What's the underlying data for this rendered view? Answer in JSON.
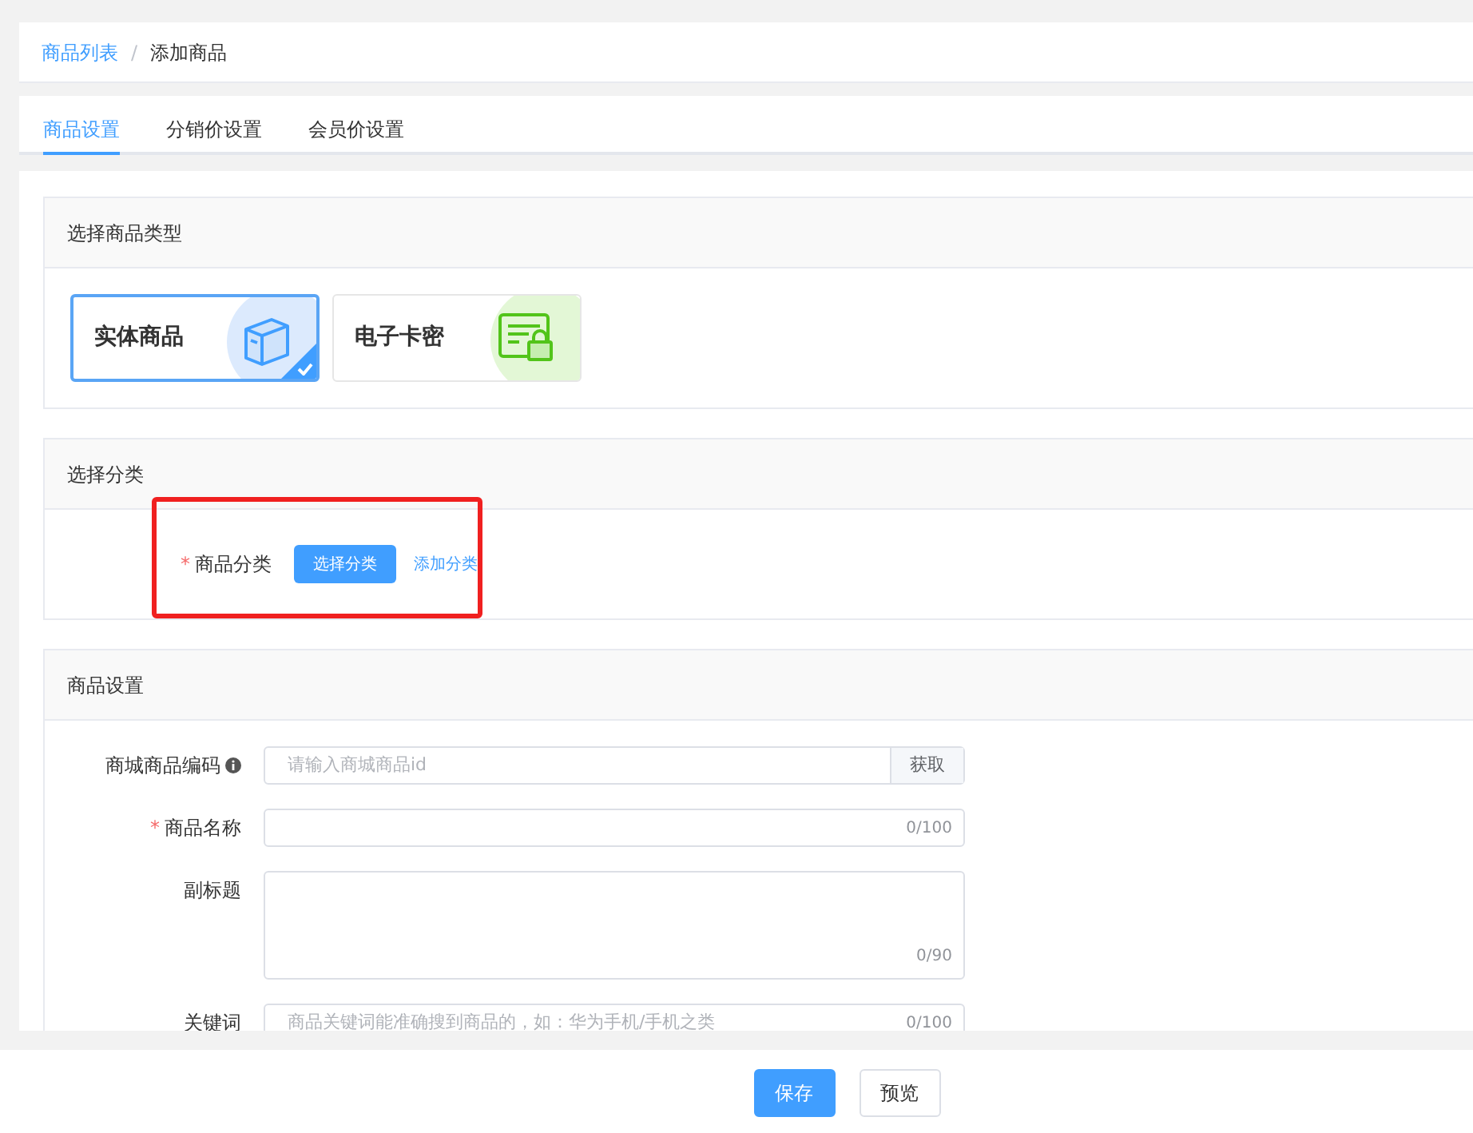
{
  "breadcrumb": {
    "separator": "/",
    "items": [
      {
        "label": "商品列表",
        "link": true
      },
      {
        "label": "添加商品",
        "link": false
      }
    ]
  },
  "tabs": [
    {
      "label": "商品设置",
      "selected": true
    },
    {
      "label": "分销价设置",
      "selected": false
    },
    {
      "label": "会员价设置",
      "selected": false
    }
  ],
  "type_section": {
    "title": "选择商品类型",
    "types": [
      {
        "label": "实体商品",
        "kind": "physical",
        "selected": true
      },
      {
        "label": "电子卡密",
        "kind": "card",
        "selected": false
      }
    ]
  },
  "category_section": {
    "title": "选择分类",
    "highlighted": true,
    "label": "商品分类",
    "required_mark": "*",
    "select_button": "选择分类",
    "add_link": "添加分类"
  },
  "settings_section": {
    "title": "商品设置",
    "fields": [
      {
        "kind": "fetch",
        "label": "商城商品编码",
        "info": true,
        "placeholder": "请输入商城商品id",
        "button": "获取"
      },
      {
        "kind": "counter",
        "label": "商品名称",
        "required_mark": "*",
        "counter": "0/100"
      },
      {
        "kind": "textarea",
        "label": "副标题",
        "counter": "0/90"
      },
      {
        "kind": "counter",
        "label": "关键词",
        "placeholder": "商品关键词能准确搜到商品的，如：华为手机/手机之类",
        "counter": "0/100"
      }
    ]
  },
  "footer": {
    "save": "保存",
    "preview": "预览"
  }
}
